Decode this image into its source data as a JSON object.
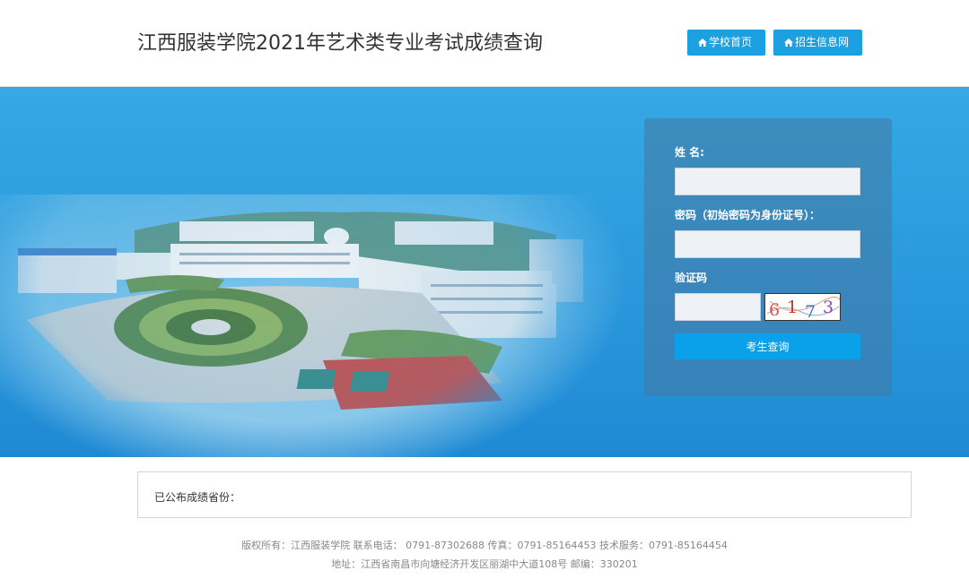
{
  "header": {
    "title": "江西服装学院2021年艺术类专业考试成绩查询",
    "nav": {
      "school_home": "学校首页",
      "admissions_site": "招生信息网"
    },
    "icon": "home-icon"
  },
  "login": {
    "name_label": "姓  名:",
    "password_label": "密码（初始密码为身份证号）：",
    "captcha_label": "验证码",
    "captcha_text": "6173",
    "submit_label": "考生查询",
    "name_value": "",
    "password_value": "",
    "captcha_value": ""
  },
  "notice": {
    "text": "已公布成绩省份："
  },
  "footer": {
    "line1": "版权所有：江西服装学院 联系电话： 0791-87302688  传真：0791-85164453  技术服务：0791-85164454",
    "line2": "地址：江西省南昌市向塘经济开发区丽湖中大道108号 邮编：330201"
  },
  "colors": {
    "accent": "#1ba1e2",
    "banner": "#2b9bde",
    "panel": "#4678a0"
  }
}
